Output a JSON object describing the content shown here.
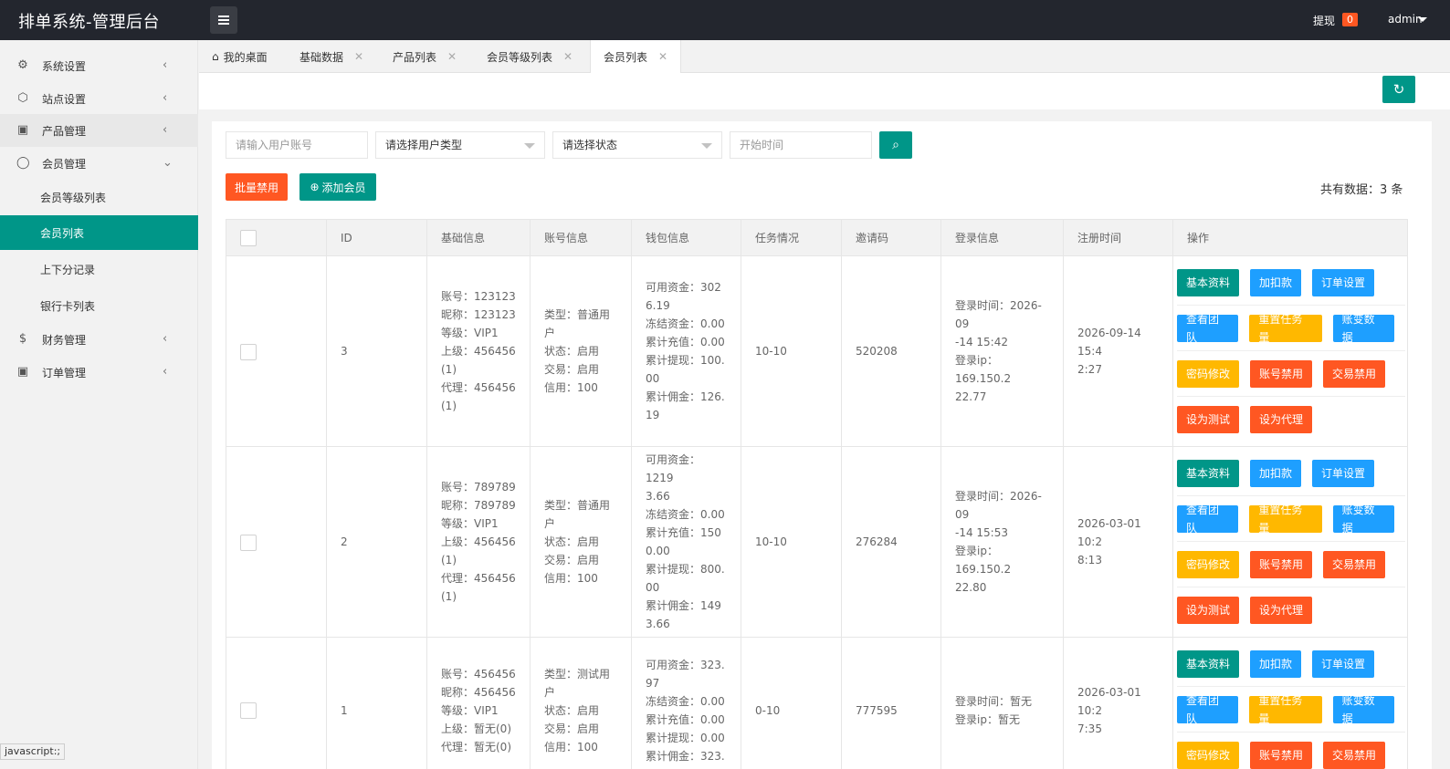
{
  "header": {
    "brand": "排单系统-管理后台",
    "withdraw_label": "提现",
    "withdraw_count": "0",
    "user": "admin"
  },
  "sidebar": {
    "items": [
      {
        "label": "系统设置",
        "icon": "gear-icon"
      },
      {
        "label": "站点设置",
        "icon": "site-icon"
      },
      {
        "label": "产品管理",
        "icon": "box-icon"
      },
      {
        "label": "会员管理",
        "icon": "user-icon"
      },
      {
        "label": "会员等级列表"
      },
      {
        "label": "会员列表"
      },
      {
        "label": "上下分记录"
      },
      {
        "label": "银行卡列表"
      },
      {
        "label": "财务管理",
        "icon": "dollar-icon"
      },
      {
        "label": "订单管理",
        "icon": "box-icon"
      }
    ]
  },
  "tabs": [
    {
      "label": "我的桌面"
    },
    {
      "label": "基础数据"
    },
    {
      "label": "产品列表"
    },
    {
      "label": "会员等级列表"
    },
    {
      "label": "会员列表"
    }
  ],
  "filters": {
    "account_placeholder": "请输入用户账号",
    "type_select": "请选择用户类型",
    "status_select": "请选择状态",
    "start_time_placeholder": "开始时间"
  },
  "actions": {
    "batch_disable": "批量禁用",
    "add_member": "添加会员",
    "total": "共有数据：3 条"
  },
  "table": {
    "headers": [
      "ID",
      "基础信息",
      "账号信息",
      "钱包信息",
      "任务情况",
      "邀请码",
      "登录信息",
      "注册时间",
      "操作"
    ],
    "op_labels": [
      "基本资料",
      "加扣款",
      "订单设置",
      "查看团队",
      "重置任务量",
      "账变数据",
      "密码修改",
      "账号禁用",
      "交易禁用",
      "设为测试",
      "设为代理"
    ],
    "rows": [
      {
        "id": "3",
        "basic": [
          "账号：123123",
          "昵称：123123",
          "等级：VIP1",
          "上级：456456",
          "(1)",
          "代理：456456",
          "(1)"
        ],
        "account": [
          "类型：普通用",
          "户",
          "状态：启用",
          "交易：启用",
          "信用：100"
        ],
        "wallet": [
          "可用资金：302",
          "6.19",
          "冻结资金：0.00",
          "累计充值：0.00",
          "累计提现：100.",
          "00",
          "累计佣金：126.",
          "19"
        ],
        "task": "10-10",
        "invite": "520208",
        "login": [
          "登录时间：2026-09",
          "-14 15:42",
          "登录ip：169.150.2",
          "22.77"
        ],
        "reg": [
          "2026-09-14 15:4",
          "2:27"
        ]
      },
      {
        "id": "2",
        "basic": [
          "账号：789789",
          "昵称：789789",
          "等级：VIP1",
          "上级：456456",
          "(1)",
          "代理：456456",
          "(1)"
        ],
        "account": [
          "类型：普通用",
          "户",
          "状态：启用",
          "交易：启用",
          "信用：100"
        ],
        "wallet": [
          "可用资金：1219",
          "3.66",
          "冻结资金：0.00",
          "累计充值：150",
          "0.00",
          "累计提现：800.",
          "00",
          "累计佣金：149",
          "3.66"
        ],
        "task": "10-10",
        "invite": "276284",
        "login": [
          "登录时间：2026-09",
          "-14 15:53",
          "登录ip：169.150.2",
          "22.80"
        ],
        "reg": [
          "2026-03-01 10:2",
          "8:13"
        ]
      },
      {
        "id": "1",
        "basic": [
          "账号：456456",
          "昵称：456456",
          "等级：VIP1",
          "上级：暂无(0)",
          "代理：暂无(0)"
        ],
        "account": [
          "类型：测试用",
          "户",
          "状态：启用",
          "交易：启用",
          "信用：100"
        ],
        "wallet": [
          "可用资金：323.",
          "97",
          "冻结资金：0.00",
          "累计充值：0.00",
          "累计提现：0.00",
          "累计佣金：323."
        ],
        "task": "0-10",
        "invite": "777595",
        "login": [
          "登录时间：暂无",
          "登录ip：暂无"
        ],
        "reg": [
          "2026-03-01 10:2",
          "7:35"
        ]
      }
    ]
  },
  "statusbar": "javascript:;"
}
